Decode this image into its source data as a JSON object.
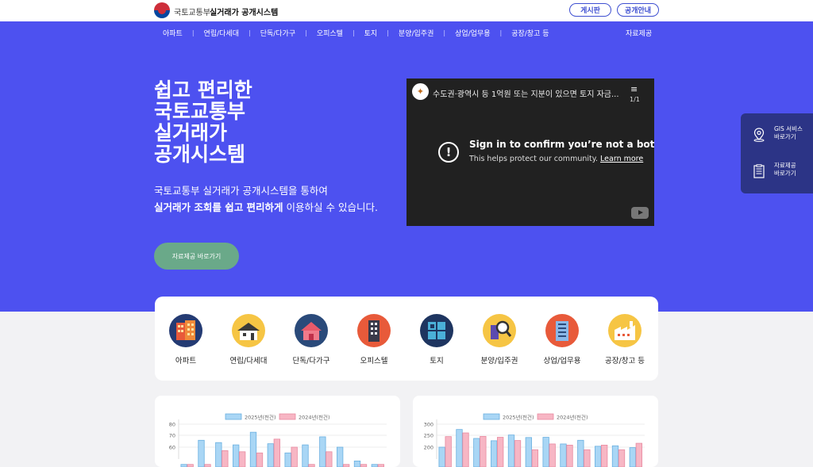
{
  "header": {
    "org": "국토교통부",
    "system": "실거래가 공개시스템",
    "btn_board": "게시판",
    "btn_info": "공개안내"
  },
  "nav": {
    "items": [
      "아파트",
      "연립/다세대",
      "단독/다가구",
      "오피스텔",
      "토지",
      "분양/입주권",
      "상업/업무용",
      "공장/창고 등"
    ],
    "data_link": "자료제공"
  },
  "hero": {
    "headline": [
      "쉽고 편리한",
      "국토교통부",
      "실거래가",
      "공개시스템"
    ],
    "desc_line1": "국토교통부 실거래가 공개시스템을 통하여",
    "desc_line2_bold": "실거래가 조회를 쉽고 편리하게",
    "desc_line2_rest": " 이용하실 수 있습니다.",
    "cta": "자료제공 바로가기"
  },
  "video": {
    "title": "수도권·광역시 등 1억원 또는 지분이 있으면 토지 자금...",
    "playlist_count": "1/1",
    "message": "Sign in to confirm you’re not a bot",
    "sub": "This helps protect our community.",
    "link": "Learn more"
  },
  "side_panel": [
    {
      "line1": "GIS 서비스",
      "line2": "바로가기",
      "icon": "map-pin-icon"
    },
    {
      "line1": "자료제공",
      "line2": "바로가기",
      "icon": "document-icon"
    }
  ],
  "categories": [
    {
      "label": "아파트",
      "icon": "apartment-icon",
      "bg": "#243b73"
    },
    {
      "label": "연립/다세대",
      "icon": "townhouse-icon",
      "bg": "#f6c544"
    },
    {
      "label": "단독/다가구",
      "icon": "house-icon",
      "bg": "#2a4a7a"
    },
    {
      "label": "오피스텔",
      "icon": "officetel-icon",
      "bg": "#e85a3a"
    },
    {
      "label": "토지",
      "icon": "land-icon",
      "bg": "#1e3560"
    },
    {
      "label": "분양/입주권",
      "icon": "magnifier-icon",
      "bg": "#f6c544"
    },
    {
      "label": "상업/업무용",
      "icon": "office-building-icon",
      "bg": "#e85a3a"
    },
    {
      "label": "공장/창고 등",
      "icon": "factory-icon",
      "bg": "#f6c544"
    }
  ],
  "colors": {
    "hero_bg": "#4d51f0",
    "accent": "#3e4fd1",
    "cta_bg": "#6aa989",
    "series_2025": "#a9d6f5",
    "series_2024": "#f7b6c4"
  },
  "chart_data": [
    {
      "type": "bar",
      "legend": [
        "2025년(천건)",
        "2024년(천건)"
      ],
      "y_ticks": [
        "80",
        "70",
        "60"
      ],
      "series": [
        {
          "name": "2025년(천건)",
          "values": [
            45,
            66,
            64,
            62,
            73,
            63,
            55,
            62,
            69,
            60,
            48,
            45
          ]
        },
        {
          "name": "2024년(천건)",
          "values": [
            45,
            45,
            57,
            56,
            55,
            67,
            60,
            45,
            56,
            45,
            45,
            45
          ]
        }
      ]
    },
    {
      "type": "bar",
      "legend": [
        "2025년(천건)",
        "2024년(천건)"
      ],
      "y_ticks": [
        "300",
        "250",
        "200"
      ],
      "series": [
        {
          "name": "2025년(천건)",
          "values": [
            200,
            277,
            238,
            228,
            253,
            242,
            243,
            214,
            230,
            204,
            206,
            198
          ]
        },
        {
          "name": "2024년(천건)",
          "values": [
            246,
            262,
            247,
            243,
            229,
            189,
            214,
            209,
            189,
            209,
            189,
            217
          ]
        }
      ]
    }
  ]
}
